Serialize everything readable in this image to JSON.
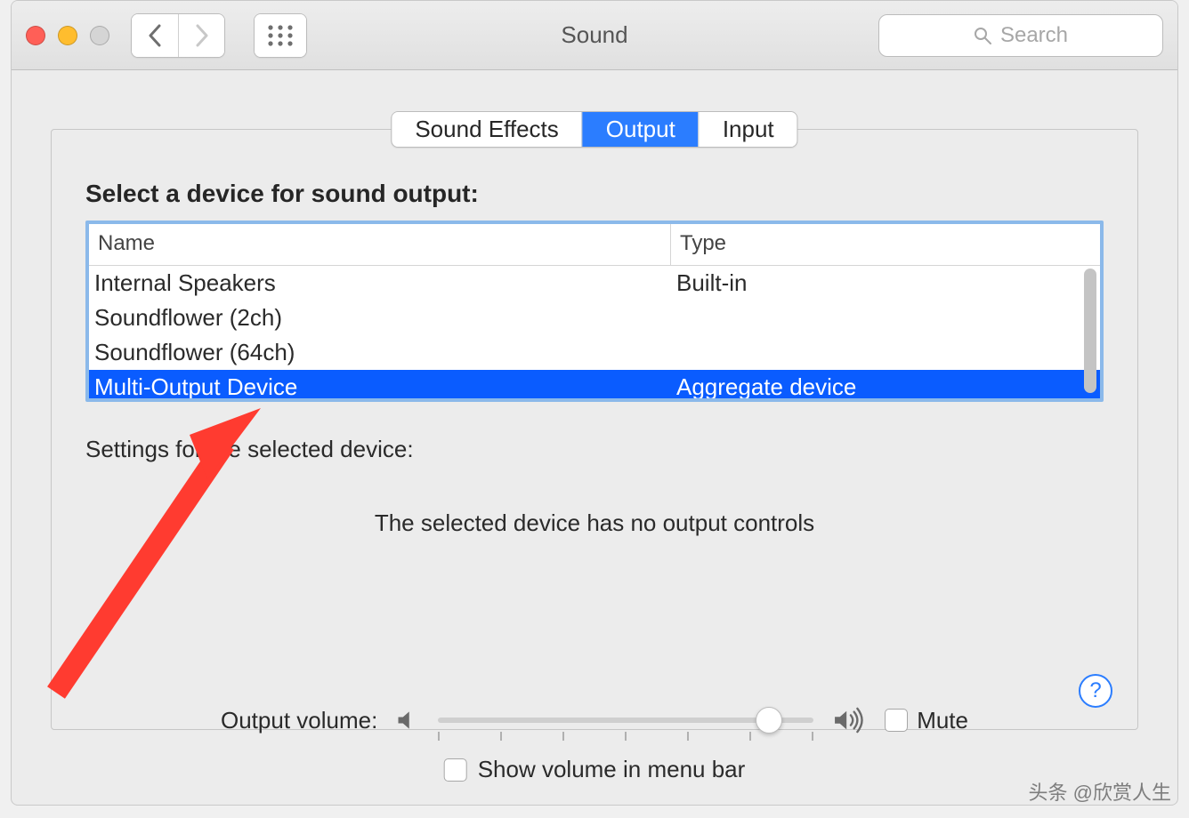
{
  "window": {
    "title": "Sound"
  },
  "search": {
    "placeholder": "Search"
  },
  "tabs": {
    "sound_effects": "Sound Effects",
    "output": "Output",
    "input": "Input"
  },
  "output_section": {
    "heading": "Select a device for sound output:",
    "columns": {
      "name": "Name",
      "type": "Type"
    },
    "devices": [
      {
        "name": "Internal Speakers",
        "type": "Built-in",
        "selected": false
      },
      {
        "name": "Soundflower (2ch)",
        "type": "",
        "selected": false
      },
      {
        "name": "Soundflower (64ch)",
        "type": "",
        "selected": false
      },
      {
        "name": "Multi-Output Device",
        "type": "Aggregate device",
        "selected": true
      }
    ],
    "settings_label": "Settings for the selected device:",
    "no_controls": "The selected device has no output controls"
  },
  "volume": {
    "label": "Output volume:",
    "mute": "Mute",
    "show_in_menu_bar": "Show volume in menu bar"
  },
  "help_symbol": "?",
  "watermark": "头条 @欣赏人生"
}
